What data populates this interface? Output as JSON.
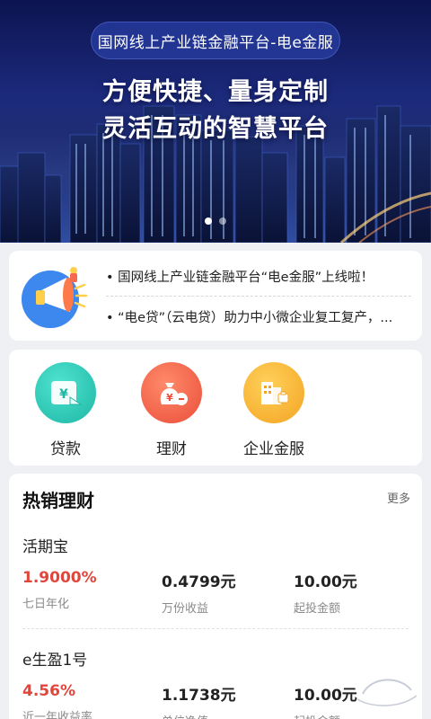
{
  "banner": {
    "pill_text": "国网线上产业链金融平台-电e金服",
    "headline_1": "方便快捷、量身定制",
    "headline_2": "灵活互动的智慧平台",
    "slide_count": 2,
    "active_slide": 1
  },
  "notice": {
    "items": [
      "• 国网线上产业链金融平台“电e金服”上线啦！",
      "• “电e贷”（云电贷）助力中小微企业复工复产，..."
    ]
  },
  "menu": {
    "items": [
      {
        "label": "贷款",
        "icon": "loan-icon",
        "color": "#2fcab8"
      },
      {
        "label": "理财",
        "icon": "money-bag-icon",
        "color": "#f46a4e"
      },
      {
        "label": "企业金服",
        "icon": "building-icon",
        "color": "#f7b73a"
      }
    ]
  },
  "products": {
    "title": "热销理财",
    "more": "更多",
    "items": [
      {
        "name": "活期宝",
        "rate": "1.9000%",
        "rate_label": "七日年化",
        "mid_value": "0.4799元",
        "mid_label": "万份收益",
        "min_invest": "10.00元",
        "min_label": "起投金额"
      },
      {
        "name": "e生盈1号",
        "rate": "4.56%",
        "rate_label": "近一年收益率",
        "mid_value": "1.1738元",
        "mid_label": "单位净值",
        "min_invest": "10.00元",
        "min_label": "起投金额"
      }
    ]
  },
  "colors": {
    "accent_red": "#e0463b",
    "banner_dark": "#0c1450"
  }
}
